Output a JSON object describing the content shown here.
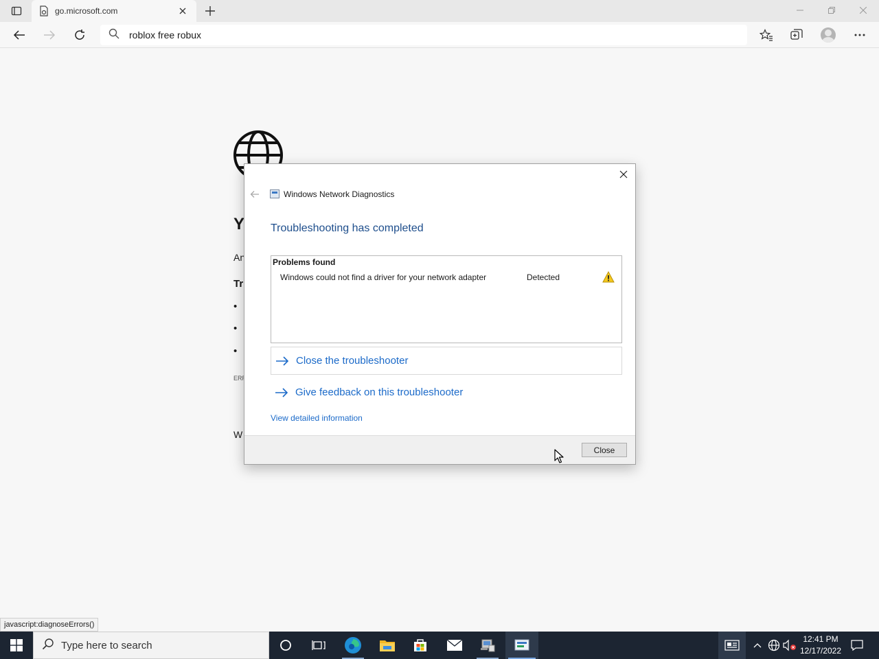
{
  "browser": {
    "tab_title": "go.microsoft.com",
    "address_text": "roblox free robux",
    "status_url": "javascript:diagnoseErrors()"
  },
  "page": {
    "fragments": {
      "heading": "Y",
      "line1": "An",
      "subheading": "Tr",
      "bullet1": "•",
      "bullet2": "•",
      "bullet3": "•",
      "err": "ERR",
      "footer": "W"
    }
  },
  "dialog": {
    "title": "Windows Network Diagnostics",
    "heading": "Troubleshooting has completed",
    "problems_header": "Problems found",
    "problem_description": "Windows could not find a driver for your network adapter",
    "problem_status": "Detected",
    "close_troubleshooter": "Close the troubleshooter",
    "give_feedback": "Give feedback on this troubleshooter",
    "view_details": "View detailed information",
    "close_button": "Close"
  },
  "taskbar": {
    "search_placeholder": "Type here to search",
    "time": "12:41 PM",
    "date": "12/17/2022"
  },
  "colors": {
    "link_blue": "#1b6ac9",
    "heading_blue": "#1e4e8c",
    "taskbar": "#1c2532"
  }
}
